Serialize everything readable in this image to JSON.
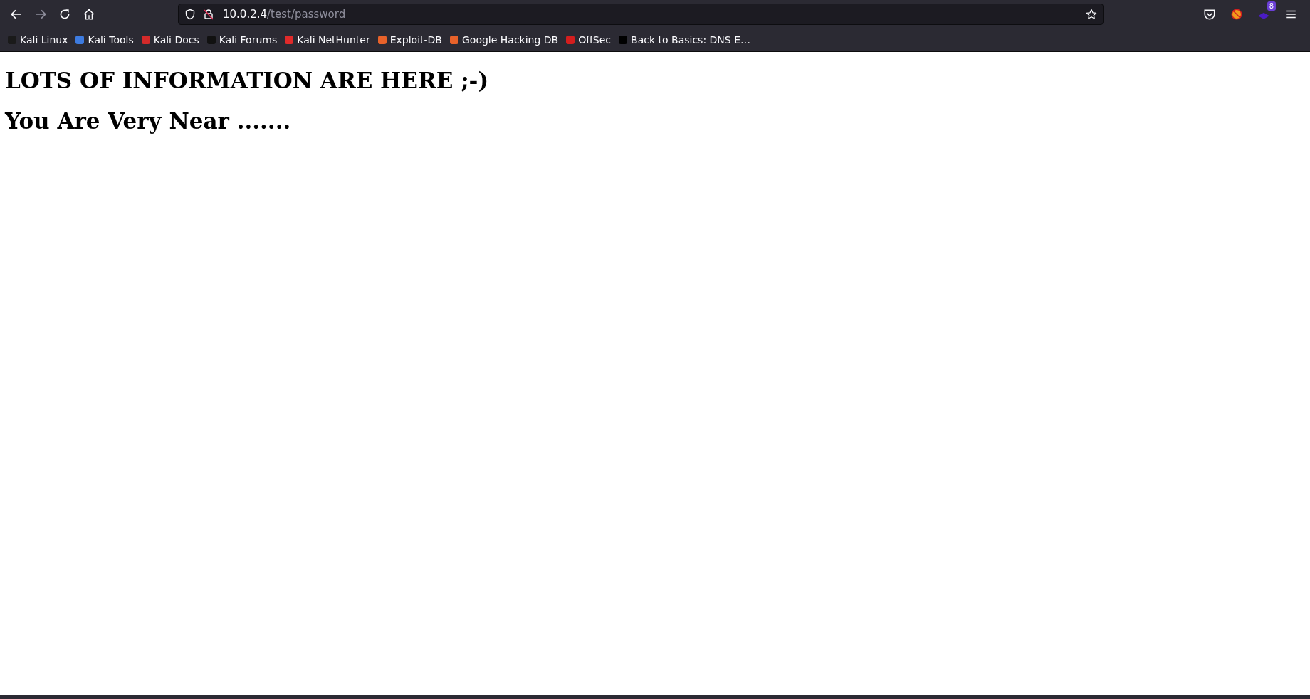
{
  "toolbar": {
    "url_host": "10.0.2.4",
    "url_path": "/test/password",
    "extension_badge": "8"
  },
  "bookmarks": [
    {
      "label": "Kali Linux",
      "color": "#1a1a1a"
    },
    {
      "label": "Kali Tools",
      "color": "#3d7be0"
    },
    {
      "label": "Kali Docs",
      "color": "#d42a2a"
    },
    {
      "label": "Kali Forums",
      "color": "#111111"
    },
    {
      "label": "Kali NetHunter",
      "color": "#e02a2a"
    },
    {
      "label": "Exploit-DB",
      "color": "#e8622a"
    },
    {
      "label": "Google Hacking DB",
      "color": "#e8622a"
    },
    {
      "label": "OffSec",
      "color": "#d41e1e"
    },
    {
      "label": "Back to Basics: DNS E…",
      "color": "#000000"
    }
  ],
  "page": {
    "headings": [
      "LOTS OF INFORMATION ARE HERE ;-)",
      "You Are Very Near ......."
    ]
  }
}
